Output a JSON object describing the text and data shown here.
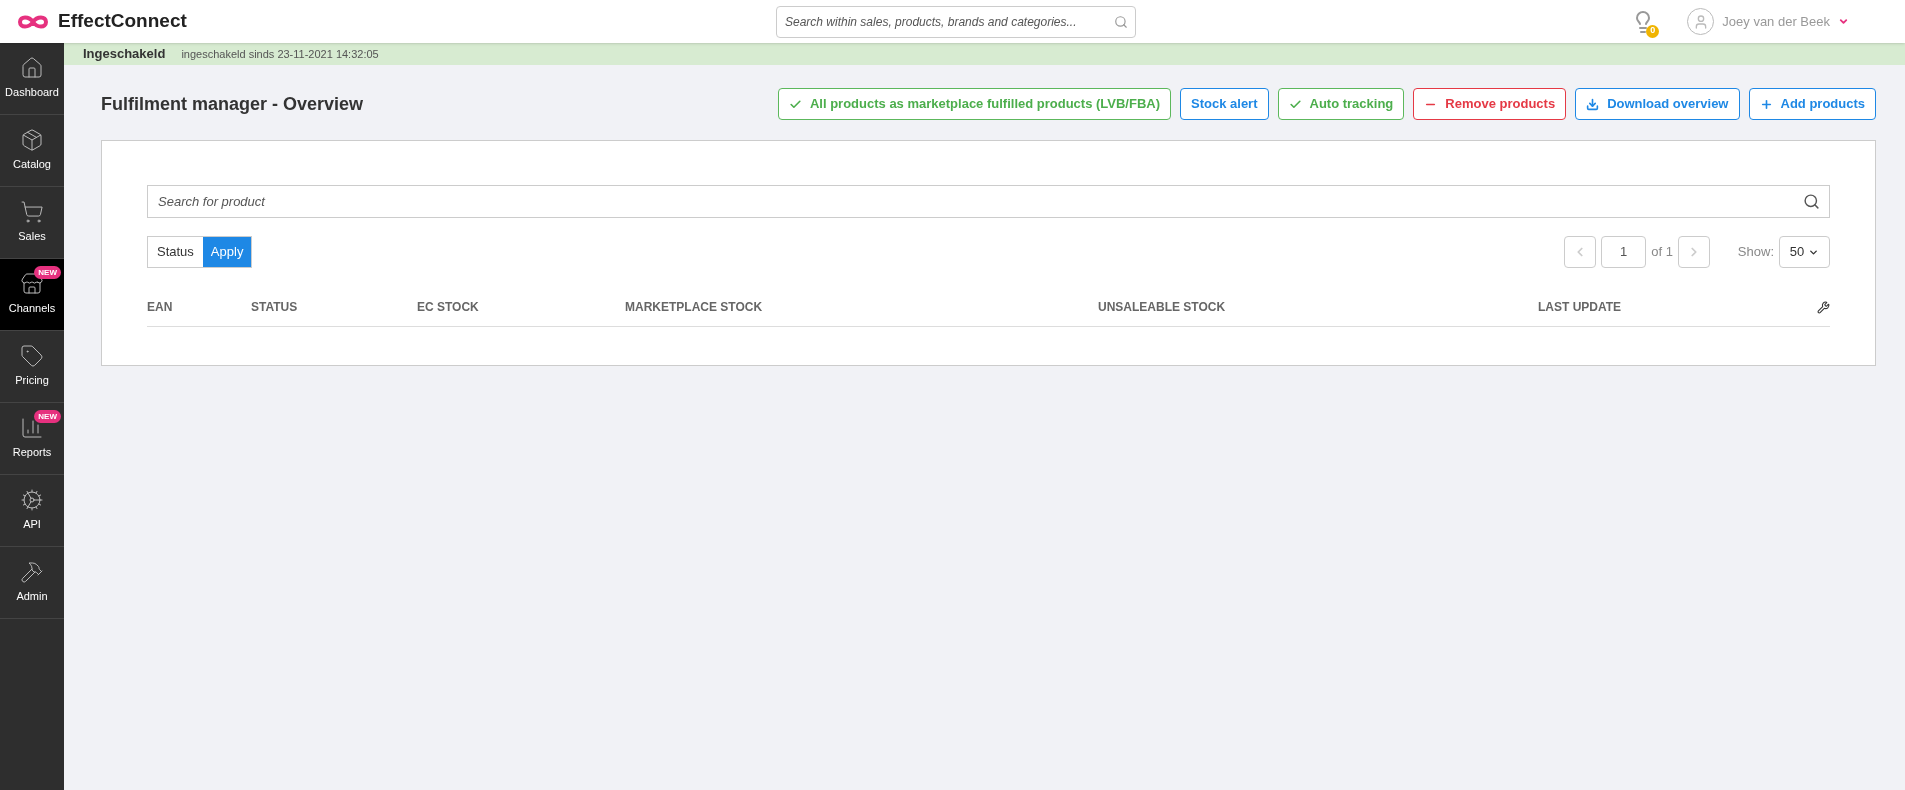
{
  "header": {
    "logo": "EffectConnect",
    "search": {
      "placeholder": "Search within sales, products, brands and categories..."
    },
    "notifications_count": "0",
    "user": "Joey van der Beek"
  },
  "sidebar": {
    "items": [
      {
        "label": "Dashboard",
        "selected": false
      },
      {
        "label": "Catalog",
        "selected": false
      },
      {
        "label": "Sales",
        "selected": false
      },
      {
        "label": "Channels",
        "selected": true,
        "badge": "NEW"
      },
      {
        "label": "Pricing",
        "selected": false
      },
      {
        "label": "Reports",
        "selected": false,
        "badge": "NEW"
      },
      {
        "label": "API",
        "selected": false
      },
      {
        "label": "Admin",
        "selected": false
      }
    ]
  },
  "status_bar": {
    "title": "Ingeschakeld",
    "detail": "ingeschakeld sinds 23-11-2021 14:32:05"
  },
  "page": {
    "title": "Fulfilment manager - Overview",
    "actions": [
      {
        "label": "All products as marketplace fulfilled products (LVB/FBA)",
        "kind": "success"
      },
      {
        "label": "Stock alert",
        "kind": "primary"
      },
      {
        "label": "Auto tracking",
        "kind": "success"
      },
      {
        "label": "Remove products",
        "kind": "danger"
      },
      {
        "label": "Download overview",
        "kind": "primary"
      },
      {
        "label": "Add products",
        "kind": "primary"
      }
    ]
  },
  "panel": {
    "search": {
      "placeholder": "Search for product"
    },
    "filter": {
      "label": "Status",
      "apply": "Apply"
    },
    "pagination": {
      "page": "1",
      "of": "of 1",
      "show_label": "Show:",
      "show_value": "50"
    },
    "table": {
      "columns": [
        "EAN",
        "STATUS",
        "EC STOCK",
        "MARKETPLACE STOCK",
        "UNSALEABLE STOCK",
        "LAST UPDATE"
      ]
    }
  }
}
